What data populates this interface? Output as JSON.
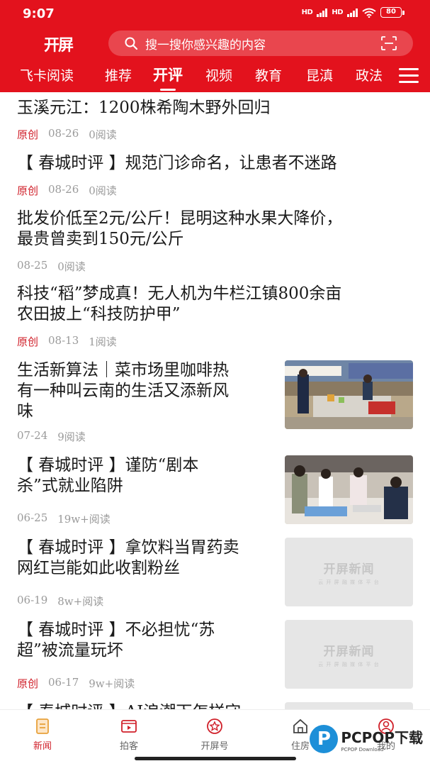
{
  "status_bar": {
    "time": "9:07",
    "signal1": "HD",
    "signal2": "HD",
    "battery": "80"
  },
  "header": {
    "logo": "开屏",
    "search_placeholder": "搜一搜你感兴趣的内容"
  },
  "tabs": [
    {
      "label": "飞卡阅读"
    },
    {
      "label": "推荐"
    },
    {
      "label": "开评"
    },
    {
      "label": "视频"
    },
    {
      "label": "教育"
    },
    {
      "label": "昆滇"
    },
    {
      "label": "政法"
    }
  ],
  "active_tab": "开评",
  "articles": [
    {
      "title": "玉溪元江：1200株希陶木野外回归",
      "badge": "原创",
      "date": "08-26",
      "reads": "0阅读"
    },
    {
      "title": "【 春城时评 】规范门诊命名，让患者不迷路",
      "badge": "原创",
      "date": "08-26",
      "reads": "0阅读"
    },
    {
      "title_lines": [
        "批发价低至2元/公斤！昆明这种水果大降价，",
        "最贵曾卖到150元/公斤"
      ],
      "badge": "",
      "date": "08-25",
      "reads": "0阅读"
    },
    {
      "title_lines": [
        "科技“稻”梦成真！无人机为牛栏江镇800余亩",
        "农田披上“科技防护甲”"
      ],
      "badge": "原创",
      "date": "08-13",
      "reads": "1阅读"
    },
    {
      "title_lines": [
        "生活新算法｜菜市场里咖啡热",
        "有一种叫云南的生活又添新风",
        "味"
      ],
      "badge": "",
      "date": "07-24",
      "reads": "9阅读",
      "image": "market-stall-photo"
    },
    {
      "title_lines": [
        "【 春城时评 】谨防“剧本",
        "杀”式就业陷阱"
      ],
      "badge": "",
      "date": "06-25",
      "reads": "19w+阅读",
      "image": "job-fair-photo"
    },
    {
      "title_lines": [
        "【 春城时评 】拿饮料当胃药卖",
        "网红岂能如此收割粉丝"
      ],
      "badge": "",
      "date": "06-19",
      "reads": "8w+阅读",
      "image_text": "开屏新闻",
      "image_sub": "云 开 屏 融 媒 体 平 台"
    },
    {
      "title_lines": [
        "【 春城时评 】不必担忧“苏",
        "超”被流量玩坏"
      ],
      "badge": "原创",
      "date": "06-17",
      "reads": "9w+阅读",
      "image_text": "开屏新闻",
      "image_sub": "云 开 屏 融 媒 体 平 台"
    },
    {
      "title_lines": [
        "【 春城时评 】AI浪潮下怎样守"
      ],
      "badge": "",
      "date": "",
      "reads": ""
    }
  ],
  "bottom_nav": [
    {
      "label": "新闻",
      "icon": "news-icon"
    },
    {
      "label": "拍客",
      "icon": "video-icon"
    },
    {
      "label": "开屏号",
      "icon": "star-badge-icon"
    },
    {
      "label": "住房",
      "icon": "home-icon"
    },
    {
      "label": "我的",
      "icon": "user-icon"
    }
  ],
  "colors": {
    "brand": "#e3121d",
    "accent": "#d0202a",
    "meta": "#9a9a9a"
  },
  "watermark": {
    "logo": "P",
    "text": "PCPOP下载",
    "sub": "PCPOP Download"
  }
}
